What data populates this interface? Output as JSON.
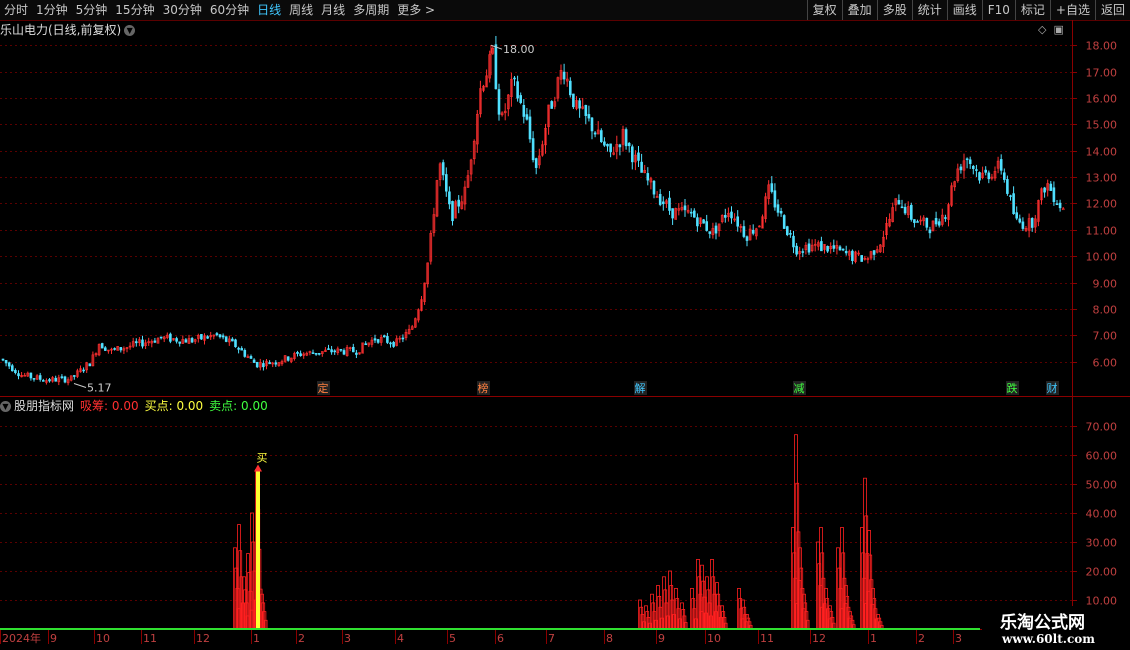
{
  "toolbar": {
    "periods": [
      "分时",
      "1分钟",
      "5分钟",
      "15分钟",
      "30分钟",
      "60分钟",
      "日线",
      "周线",
      "月线",
      "多周期",
      "更多 >"
    ],
    "active_period": "日线",
    "tools": [
      "复权",
      "叠加",
      "多股",
      "统计",
      "画线",
      "F10",
      "标记",
      "+自选",
      "返回"
    ]
  },
  "kline": {
    "title": "乐山电力(日线,前复权)",
    "high_label": "18.00",
    "low_label": "5.17",
    "y_ticks": [
      "18.00",
      "17.00",
      "16.00",
      "15.00",
      "14.00",
      "13.00",
      "12.00",
      "11.00",
      "10.00",
      "9.00",
      "8.00",
      "7.00",
      "6.00"
    ],
    "events": [
      {
        "label": "定",
        "color": "#ff8040"
      },
      {
        "label": "榜",
        "color": "#ff8040"
      },
      {
        "label": "解",
        "color": "#40c8ff"
      },
      {
        "label": "减",
        "color": "#40ff40"
      },
      {
        "label": "跌",
        "color": "#40ff40"
      },
      {
        "label": "财",
        "color": "#40c8ff"
      }
    ],
    "colors": {
      "up": "#ff3030",
      "down": "#50e0ff"
    }
  },
  "indicator": {
    "name": "股朋指标网",
    "items": [
      {
        "key": "吸筹",
        "value": "0.00",
        "color": "#ff3030"
      },
      {
        "key": "买点",
        "value": "0.00",
        "color": "#ffff40"
      },
      {
        "key": "卖点",
        "value": "0.00",
        "color": "#40ff40"
      }
    ],
    "buy_label": "买",
    "y_ticks": [
      "70.00",
      "60.00",
      "50.00",
      "40.00",
      "30.00",
      "20.00",
      "10.00"
    ]
  },
  "time_axis": [
    "2024年",
    "9",
    "10",
    "11",
    "12",
    "1",
    "2",
    "3",
    "4",
    "5",
    "6",
    "7",
    "8",
    "9",
    "10",
    "11",
    "12",
    "1",
    "2",
    "3"
  ],
  "watermark": {
    "line1": "乐淘公式网",
    "line2": "www.60lt.com"
  },
  "chart_data": [
    {
      "type": "candlestick",
      "title": "乐山电力(日线,前复权)",
      "ylim": [
        5,
        18.5
      ],
      "y_ticks": [
        6,
        7,
        8,
        9,
        10,
        11,
        12,
        13,
        14,
        15,
        16,
        17,
        18
      ],
      "annotations": {
        "max": 18.0,
        "min": 5.17
      },
      "x_labels": [
        "2024年",
        "9",
        "10",
        "11",
        "12",
        "1",
        "2",
        "3",
        "4",
        "5",
        "6",
        "7",
        "8",
        "9",
        "10",
        "11",
        "12",
        "1",
        "2",
        "3"
      ],
      "close_trend": [
        {
          "x": "2024年",
          "y": 6.0
        },
        {
          "x": "9",
          "y": 5.3
        },
        {
          "x": "10",
          "y": 6.6
        },
        {
          "x": "11",
          "y": 6.8
        },
        {
          "x": "12",
          "y": 7.0
        },
        {
          "x": "1",
          "y": 6.3
        },
        {
          "x": "2",
          "y": 6.5
        },
        {
          "x": "3",
          "y": 6.5
        },
        {
          "x": "4",
          "y": 7.0
        },
        {
          "x": "5",
          "y": 12.0
        },
        {
          "x": "6",
          "y": 16.0
        },
        {
          "x": "7",
          "y": 14.0
        },
        {
          "x": "8",
          "y": 14.0
        },
        {
          "x": "9",
          "y": 12.0
        },
        {
          "x": "10",
          "y": 11.0
        },
        {
          "x": "11",
          "y": 11.8
        },
        {
          "x": "12",
          "y": 10.1
        },
        {
          "x": "1",
          "y": 11.5
        },
        {
          "x": "2",
          "y": 13.3
        },
        {
          "x": "3",
          "y": 11.8
        }
      ]
    },
    {
      "type": "bar",
      "title": "股朋指标网",
      "ylim": [
        0,
        80
      ],
      "y_ticks": [
        10,
        20,
        30,
        40,
        50,
        60,
        70
      ],
      "series": [
        {
          "name": "吸筹",
          "color": "#ff3030",
          "peaks": [
            {
              "x": "12",
              "y": 36
            },
            {
              "x": "1",
              "y": 55
            },
            {
              "x": "8",
              "y": 18
            },
            {
              "x": "9",
              "y": 24
            },
            {
              "x": "10",
              "y": 14
            },
            {
              "x": "11",
              "y": 67
            },
            {
              "x": "12",
              "y": 35
            },
            {
              "x": "12",
              "y": 52
            }
          ]
        },
        {
          "name": "买点",
          "color": "#ffff40",
          "peaks": [
            {
              "x": "1",
              "y": 55
            }
          ]
        },
        {
          "name": "卖点",
          "color": "#40ff40",
          "peaks": []
        }
      ]
    }
  ]
}
